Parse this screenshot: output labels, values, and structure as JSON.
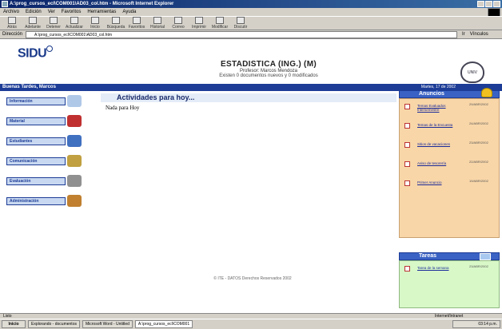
{
  "window": {
    "title": "A:\\prog_cursos_ecl\\COM001\\AD03_col.htm - Microsoft Internet Explorer"
  },
  "menu": [
    "Archivo",
    "Edición",
    "Ver",
    "Favoritos",
    "Herramientas",
    "Ayuda"
  ],
  "toolbar": [
    {
      "label": "Atrás",
      "icon": "back-icon"
    },
    {
      "label": "Adelante",
      "icon": "forward-icon"
    },
    {
      "label": "Detener",
      "icon": "stop-icon"
    },
    {
      "label": "Actualizar",
      "icon": "refresh-icon"
    },
    {
      "label": "Inicio",
      "icon": "home-icon"
    },
    {
      "label": "Búsqueda",
      "icon": "search-icon"
    },
    {
      "label": "Favoritos",
      "icon": "favorites-icon"
    },
    {
      "label": "Historial",
      "icon": "history-icon"
    },
    {
      "label": "Correo",
      "icon": "mail-icon"
    },
    {
      "label": "Imprimir",
      "icon": "print-icon"
    },
    {
      "label": "Modificar",
      "icon": "edit-icon"
    },
    {
      "label": "Discutir",
      "icon": "discuss-icon"
    }
  ],
  "address": {
    "label": "Dirección",
    "value": "A:\\prog_cursos_ecl\\COM001\\AD03_col.htm",
    "go": "Ir",
    "links": "Vínculos"
  },
  "header": {
    "logo": "SIDU",
    "course_title": "ESTADISTICA (ING.) (M)",
    "professor": "Profesor: Marcos Mendoza",
    "docs": "Existen 0 documentos nuevos y 0 modificados",
    "seal": "UNIV"
  },
  "greeting": "Buenas Tardes, Marcos",
  "date": "Martes, 17 de 2002",
  "nav": [
    {
      "label": "Información",
      "color": "#b0c8e8"
    },
    {
      "label": "Material",
      "color": "#c03030"
    },
    {
      "label": "Estudiantes",
      "color": "#4070c0"
    },
    {
      "label": "Comunicación",
      "color": "#c0a040"
    },
    {
      "label": "Evaluación",
      "color": "#909090"
    },
    {
      "label": "Administración",
      "color": "#c08030"
    }
  ],
  "main": {
    "title": "Actividades para hoy...",
    "empty": "Nada para Hoy"
  },
  "anuncios": {
    "title": "Anuncios",
    "items": [
      {
        "text": "Temas Evaluados Intersemestre",
        "date": "29/ABR/2002"
      },
      {
        "text": "Temas de la Encuesta",
        "date": "24/ABR/2002"
      },
      {
        "text": "Sitios de vacaciones",
        "date": "23/ABR/2002"
      },
      {
        "text": "Aviso de tesorería",
        "date": "22/ABR/2002"
      },
      {
        "text": "Primer Anuncio",
        "date": "19/ABR/2002"
      }
    ]
  },
  "tareas": {
    "title": "Tareas",
    "items": [
      {
        "text": "Tarea de la semana",
        "date": "23/ABR/2002"
      }
    ]
  },
  "footer": "© ITE - DATOS Derechos Reservados 2002",
  "status": {
    "left": "Listo",
    "zone": "Internet/Intranet"
  },
  "taskbar": {
    "start": "Inicio",
    "items": [
      {
        "label": "Explorando - documentos",
        "active": false
      },
      {
        "label": "Microsoft Word - Untitled",
        "active": false
      },
      {
        "label": "A:\\prog_cursos_ecl\\COM001",
        "active": true
      }
    ],
    "clock": "03:14 p.m."
  }
}
